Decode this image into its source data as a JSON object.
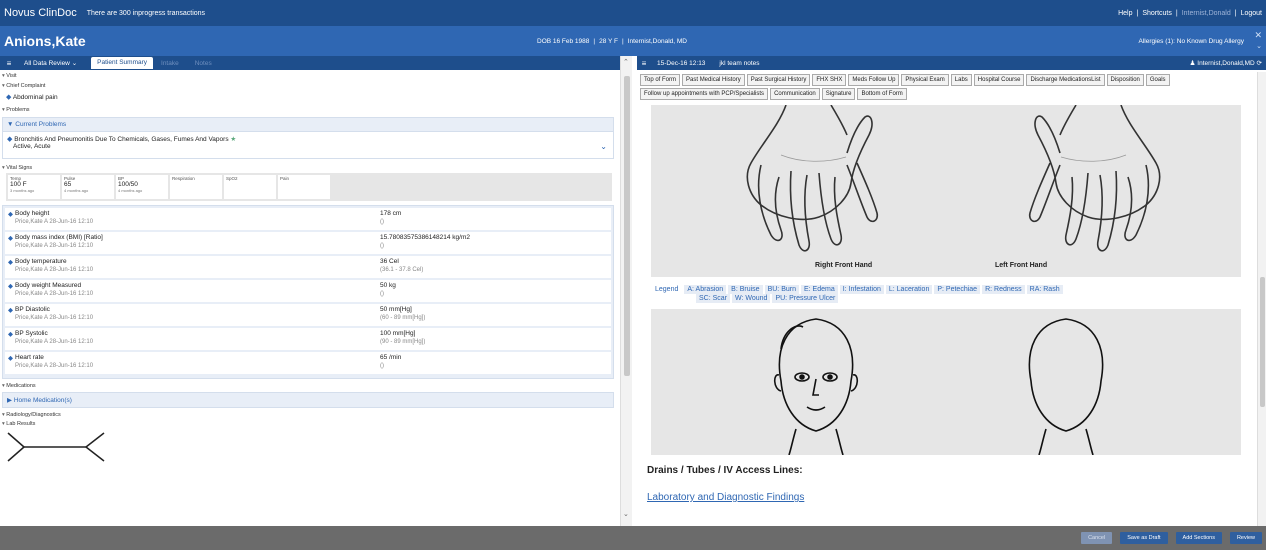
{
  "topbar": {
    "brand": "Novus ClinDoc",
    "notice": "There are 300 inprogress transactions",
    "help": "Help",
    "shortcuts": "Shortcuts",
    "user_muted": "Internist,Donald",
    "logout": "Logout"
  },
  "patient": {
    "name": "Anions,Kate",
    "dob": "DOB 16 Feb 1988",
    "age_sex": "28 Y F",
    "provider": "Internist,Donald, MD",
    "allergies": "Allergies (1): No Known Drug Allergy"
  },
  "left_tabs": {
    "view": "All Data Review",
    "active": "Patient Summary",
    "tab2": "Intake",
    "tab3": "Notes"
  },
  "left": {
    "visit_label": "Visit",
    "chief_complaint_label": "Chief Complaint",
    "chief_complaint": "Abdominal pain",
    "problems_label": "Problems",
    "current_problems": "Current Problems",
    "problem_name": "Bronchitis And Pneumonitis Due To Chemicals, Gases, Fumes And Vapors",
    "problem_status": "Active, Acute",
    "vitals_label": "Vital Signs",
    "tiles": [
      {
        "label": "Temp",
        "value": "100 F",
        "sub": "3 months ago"
      },
      {
        "label": "Pulse",
        "value": "65",
        "sub": "4 months ago"
      },
      {
        "label": "BP",
        "value": "100/50",
        "sub": "4 months ago"
      },
      {
        "label": "Respiration",
        "value": "",
        "sub": ""
      },
      {
        "label": "SpO2",
        "value": "",
        "sub": ""
      },
      {
        "label": "Pain",
        "value": "",
        "sub": ""
      }
    ],
    "vitals": [
      {
        "name": "Body height",
        "by": "Price,Kate A  28-Jun-16 12:10",
        "value": "178 cm",
        "range": "()"
      },
      {
        "name": "Body mass index (BMI) [Ratio]",
        "by": "Price,Kate A  28-Jun-16 12:10",
        "value": "15.78083575386148214 kg/m2",
        "range": "()"
      },
      {
        "name": "Body temperature",
        "by": "Price,Kate A  28-Jun-16 12:10",
        "value": "36 Cel",
        "range": "(36.1 - 37.8 Cel)"
      },
      {
        "name": "Body weight Measured",
        "by": "Price,Kate A  28-Jun-16 12:10",
        "value": "50 kg",
        "range": "()"
      },
      {
        "name": "BP Diastolic",
        "by": "Price,Kate A  28-Jun-16 12:10",
        "value": "50 mm[Hg]",
        "range": "(60 - 89 mm[Hg])"
      },
      {
        "name": "BP Systolic",
        "by": "Price,Kate A  28-Jun-16 12:10",
        "value": "100 mm[Hg]",
        "range": "(90 - 89 mm[Hg])"
      },
      {
        "name": "Heart rate",
        "by": "Price,Kate A  28-Jun-16 12:10",
        "value": "65 /min",
        "range": "()"
      }
    ],
    "medications_label": "Medications",
    "home_medications": "Home Medication(s)",
    "radiology_label": "Radiology/Diagnostics",
    "lab_label": "Lab Results"
  },
  "right": {
    "date": "15-Dec-16 12:13",
    "note_title": "jkl team notes",
    "author": "Internist,Donald,MD",
    "nav": [
      "Top of Form",
      "Past Medical History",
      "Past Surgical History",
      "FHX SHX",
      "Meds Follow Up",
      "Physical Exam",
      "Labs",
      "Hospital Course",
      "Discharge MedicationsList",
      "Disposition",
      "Goals",
      "Follow up appointments with PCP/Specialists",
      "Communication",
      "Signature",
      "Bottom of Form"
    ],
    "right_hand": "Right Front Hand",
    "left_hand": "Left Front Hand",
    "legend_label": "Legend",
    "legend_row1": [
      "A: Abrasion",
      "B: Bruise",
      "BU: Burn",
      "E: Edema",
      "I: Infestation",
      "L: Laceration",
      "P: Petechiae",
      "R: Redness",
      "RA: Rash"
    ],
    "legend_row2": [
      "SC: Scar",
      "W: Wound",
      "PU: Pressure Ulcer"
    ],
    "drains_title": "Drains / Tubes / IV Access Lines:",
    "lab_link": "Laboratory and Diagnostic Findings"
  },
  "footer": {
    "cancel": "Cancel",
    "save_draft": "Save as Draft",
    "add_sections": "Add Sections",
    "review": "Review"
  }
}
